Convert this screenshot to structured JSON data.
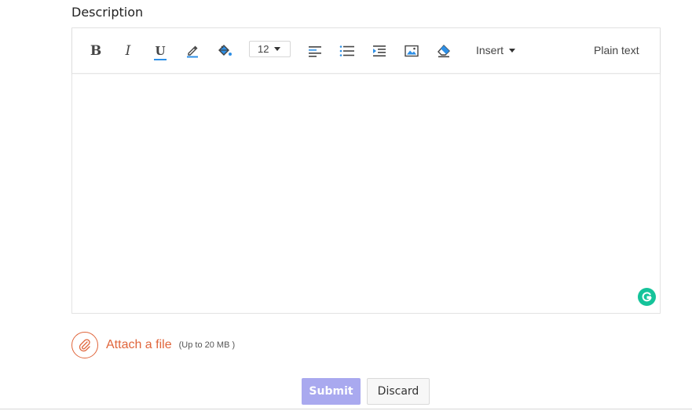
{
  "description_label": "Description",
  "toolbar": {
    "bold_label": "B",
    "italic_label": "I",
    "underline_label": "U",
    "font_size": "12",
    "insert_label": "Insert",
    "plain_text_label": "Plain text",
    "icons": [
      "bold-icon",
      "italic-icon",
      "underline-icon",
      "text-color-icon",
      "fill-color-icon",
      "align-left-icon",
      "bullet-list-icon",
      "indent-icon",
      "image-icon",
      "eraser-icon"
    ]
  },
  "attachment": {
    "label": "Attach a file",
    "hint": "(Up to 20 MB )"
  },
  "actions": {
    "submit_label": "Submit",
    "discard_label": "Discard"
  },
  "colors": {
    "accent_blue": "#2d8fe6",
    "attach_orange": "#e0653b",
    "submit_bg": "#a9a9ef",
    "grammarly_green": "#15c39a"
  }
}
